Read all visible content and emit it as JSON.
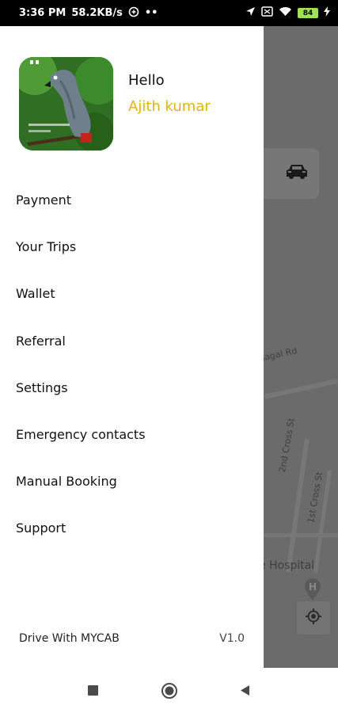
{
  "status_bar": {
    "time": "3:36 PM",
    "speed": "58.2KB/s",
    "dots": "••",
    "battery": "84",
    "icons": [
      "vpn-icon",
      "location-arrow-icon",
      "sim-icon",
      "wifi-icon",
      "battery-icon",
      "charging-icon"
    ]
  },
  "drawer": {
    "greeting": "Hello",
    "user_name": "Ajith kumar",
    "menu": [
      {
        "label": "Payment"
      },
      {
        "label": "Your Trips"
      },
      {
        "label": "Wallet"
      },
      {
        "label": "Referral"
      },
      {
        "label": "Settings"
      },
      {
        "label": "Emergency contacts"
      },
      {
        "label": "Manual Booking"
      },
      {
        "label": "Support"
      }
    ],
    "footer_link": "Drive With MYCAB",
    "version": "V1.0"
  },
  "map": {
    "labels": [
      "nagal Rd",
      "2nd Cross St",
      "1st Cross St",
      "e Hospital"
    ]
  },
  "colors": {
    "accent": "#e6b400",
    "overlay": "#6b6b6b",
    "status_bar": "#000000"
  },
  "nav_bar": {
    "icons": [
      "recents-square-icon",
      "home-circle-icon",
      "back-triangle-icon"
    ]
  }
}
